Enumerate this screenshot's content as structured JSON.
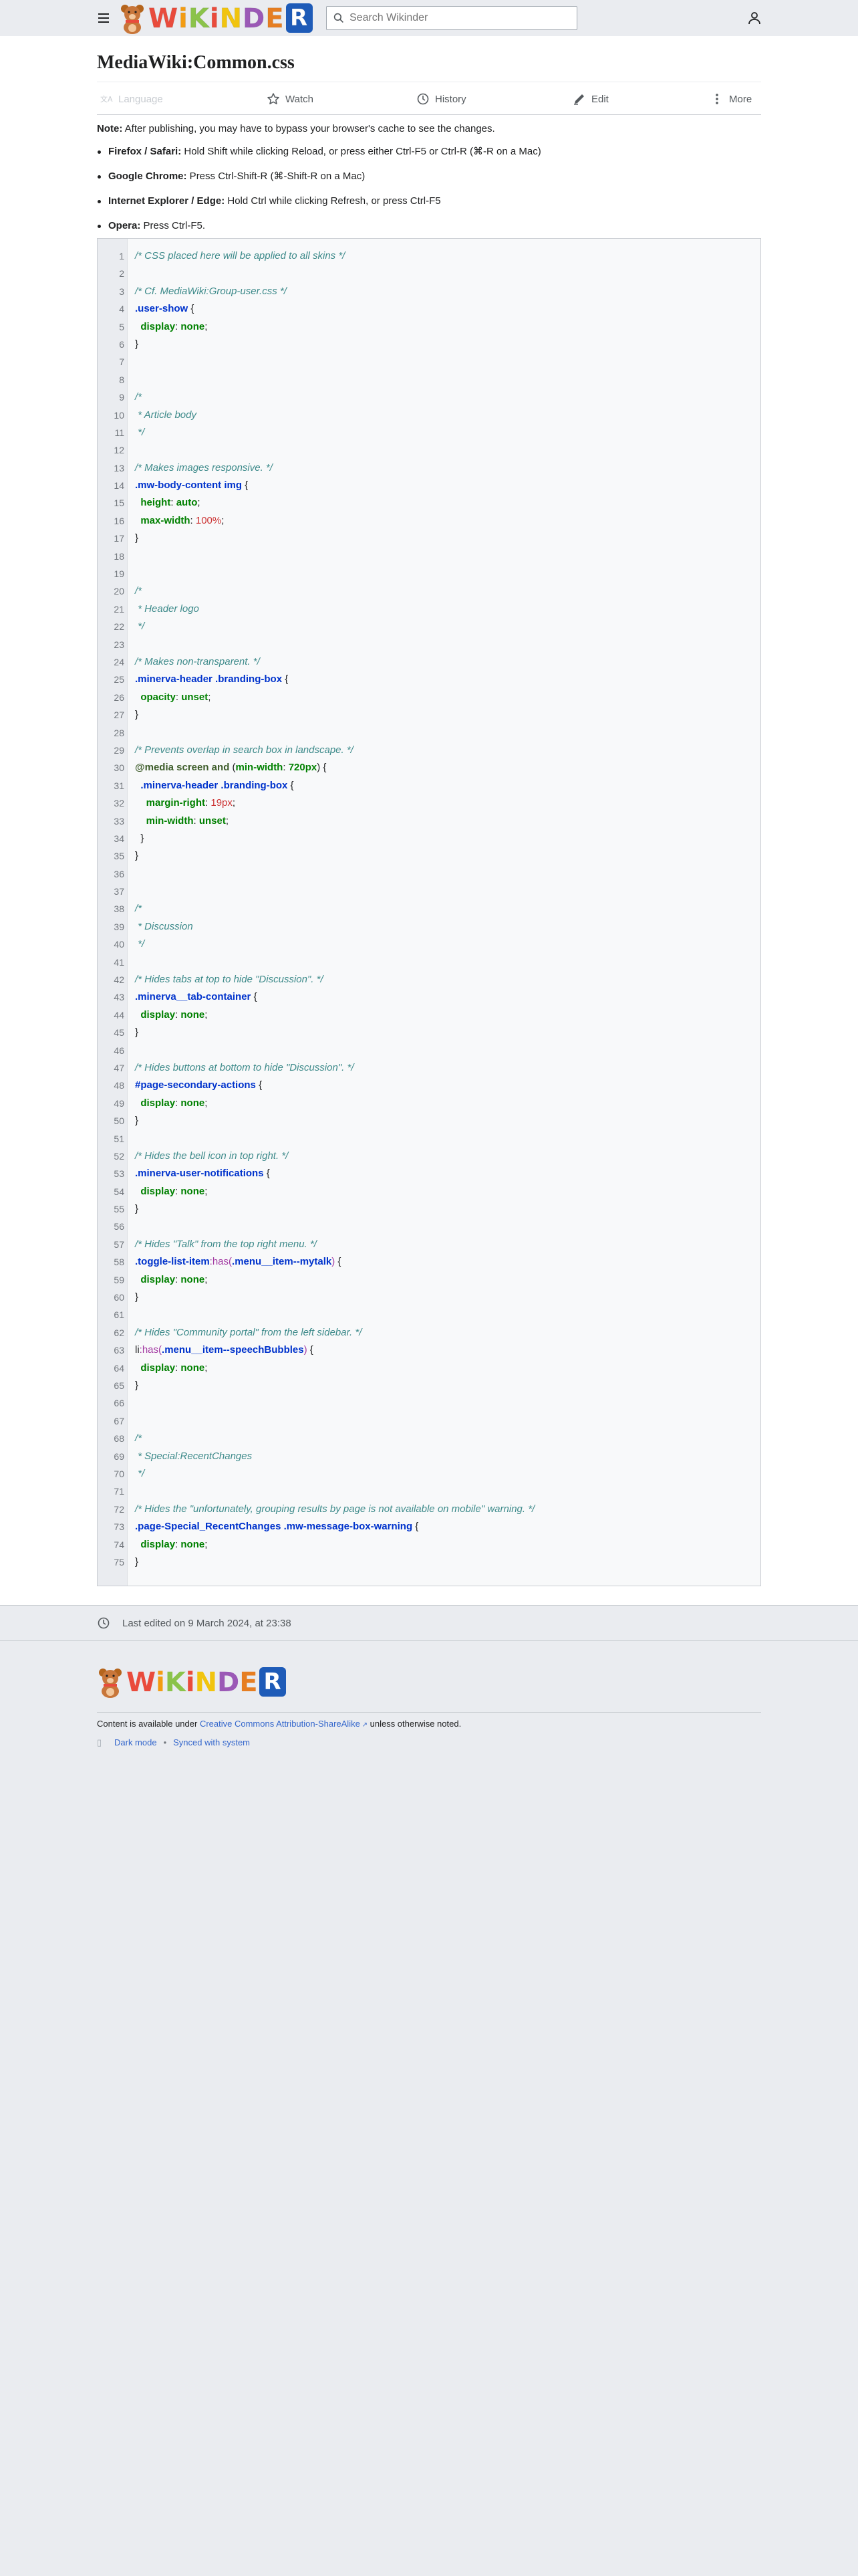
{
  "site": {
    "logo_text": [
      "W",
      "i",
      "K",
      "i",
      "N",
      "D",
      "E",
      "R"
    ],
    "logo_colors": [
      "#e94b3c",
      "#f39c12",
      "#8bc34a",
      "#e94b3c",
      "#f1c40f",
      "#9b59b6",
      "#e67e22",
      "#1e5bb8"
    ],
    "search_placeholder": "Search Wikinder"
  },
  "page": {
    "title": "MediaWiki:Common.css",
    "actions": {
      "language": "Language",
      "watch": "Watch",
      "history": "History",
      "edit": "Edit",
      "more": "More"
    },
    "note_label": "Note:",
    "note_text": " After publishing, you may have to bypass your browser's cache to see the changes.",
    "browsers": [
      {
        "name": "Firefox / Safari:",
        "text": " Hold Shift while clicking Reload, or press either Ctrl-F5 or Ctrl-R (⌘-R on a Mac)"
      },
      {
        "name": "Google Chrome:",
        "text": " Press Ctrl-Shift-R (⌘-Shift-R on a Mac)"
      },
      {
        "name": "Internet Explorer / Edge:",
        "text": " Hold Ctrl while clicking Refresh, or press Ctrl-F5"
      },
      {
        "name": "Opera:",
        "text": " Press Ctrl-F5."
      }
    ]
  },
  "code": [
    [
      [
        "c-comment",
        "/* CSS placed here will be applied to all skins */"
      ]
    ],
    [],
    [
      [
        "c-comment",
        "/* Cf. MediaWiki:Group-user.css */"
      ]
    ],
    [
      [
        "c-sel",
        ".user-show"
      ],
      [
        "c-punc",
        " {"
      ]
    ],
    [
      [
        "c-punc",
        "  "
      ],
      [
        "c-prop",
        "display"
      ],
      [
        "c-punc",
        ": "
      ],
      [
        "c-prop",
        "none"
      ],
      [
        "c-punc",
        ";"
      ]
    ],
    [
      [
        "c-punc",
        "}"
      ]
    ],
    [],
    [],
    [
      [
        "c-comment",
        "/*"
      ]
    ],
    [
      [
        "c-comment",
        " * Article body"
      ]
    ],
    [
      [
        "c-comment",
        " */"
      ]
    ],
    [],
    [
      [
        "c-comment",
        "/* Makes images responsive. */"
      ]
    ],
    [
      [
        "c-sel",
        ".mw-body-content img"
      ],
      [
        "c-punc",
        " {"
      ]
    ],
    [
      [
        "c-punc",
        "  "
      ],
      [
        "c-prop",
        "height"
      ],
      [
        "c-punc",
        ": "
      ],
      [
        "c-prop",
        "auto"
      ],
      [
        "c-punc",
        ";"
      ]
    ],
    [
      [
        "c-punc",
        "  "
      ],
      [
        "c-prop",
        "max-width"
      ],
      [
        "c-punc",
        ": "
      ],
      [
        "c-num",
        "100%"
      ],
      [
        "c-punc",
        ";"
      ]
    ],
    [
      [
        "c-punc",
        "}"
      ]
    ],
    [],
    [],
    [
      [
        "c-comment",
        "/*"
      ]
    ],
    [
      [
        "c-comment",
        " * Header logo"
      ]
    ],
    [
      [
        "c-comment",
        " */"
      ]
    ],
    [],
    [
      [
        "c-comment",
        "/* Makes non-transparent. */"
      ]
    ],
    [
      [
        "c-sel",
        ".minerva-header .branding-box"
      ],
      [
        "c-punc",
        " {"
      ]
    ],
    [
      [
        "c-punc",
        "  "
      ],
      [
        "c-prop",
        "opacity"
      ],
      [
        "c-punc",
        ": "
      ],
      [
        "c-prop",
        "unset"
      ],
      [
        "c-punc",
        ";"
      ]
    ],
    [
      [
        "c-punc",
        "}"
      ]
    ],
    [],
    [
      [
        "c-comment",
        "/* Prevents overlap in search box in landscape. */"
      ]
    ],
    [
      [
        "c-at",
        "@media screen and"
      ],
      [
        "c-punc",
        " ("
      ],
      [
        "c-prop",
        "min-width"
      ],
      [
        "c-punc",
        ": "
      ],
      [
        "c-prop",
        "720px"
      ],
      [
        "c-punc",
        ") {"
      ]
    ],
    [
      [
        "c-punc",
        "  "
      ],
      [
        "c-sel",
        ".minerva-header .branding-box"
      ],
      [
        "c-punc",
        " {"
      ]
    ],
    [
      [
        "c-punc",
        "    "
      ],
      [
        "c-prop",
        "margin-right"
      ],
      [
        "c-punc",
        ": "
      ],
      [
        "c-num",
        "19px"
      ],
      [
        "c-punc",
        ";"
      ]
    ],
    [
      [
        "c-punc",
        "    "
      ],
      [
        "c-prop",
        "min-width"
      ],
      [
        "c-punc",
        ": "
      ],
      [
        "c-prop",
        "unset"
      ],
      [
        "c-punc",
        ";"
      ]
    ],
    [
      [
        "c-punc",
        "  }"
      ]
    ],
    [
      [
        "c-punc",
        "}"
      ]
    ],
    [],
    [],
    [
      [
        "c-comment",
        "/*"
      ]
    ],
    [
      [
        "c-comment",
        " * Discussion"
      ]
    ],
    [
      [
        "c-comment",
        " */"
      ]
    ],
    [],
    [
      [
        "c-comment",
        "/* Hides tabs at top to hide \"Discussion\". */"
      ]
    ],
    [
      [
        "c-sel",
        ".minerva__tab-container"
      ],
      [
        "c-punc",
        " {"
      ]
    ],
    [
      [
        "c-punc",
        "  "
      ],
      [
        "c-prop",
        "display"
      ],
      [
        "c-punc",
        ": "
      ],
      [
        "c-prop",
        "none"
      ],
      [
        "c-punc",
        ";"
      ]
    ],
    [
      [
        "c-punc",
        "}"
      ]
    ],
    [],
    [
      [
        "c-comment",
        "/* Hides buttons at bottom to hide \"Discussion\". */"
      ]
    ],
    [
      [
        "c-sel",
        "#page-secondary-actions"
      ],
      [
        "c-punc",
        " {"
      ]
    ],
    [
      [
        "c-punc",
        "  "
      ],
      [
        "c-prop",
        "display"
      ],
      [
        "c-punc",
        ": "
      ],
      [
        "c-prop",
        "none"
      ],
      [
        "c-punc",
        ";"
      ]
    ],
    [
      [
        "c-punc",
        "}"
      ]
    ],
    [],
    [
      [
        "c-comment",
        "/* Hides the bell icon in top right. */"
      ]
    ],
    [
      [
        "c-sel",
        ".minerva-user-notifications"
      ],
      [
        "c-punc",
        " {"
      ]
    ],
    [
      [
        "c-punc",
        "  "
      ],
      [
        "c-prop",
        "display"
      ],
      [
        "c-punc",
        ": "
      ],
      [
        "c-prop",
        "none"
      ],
      [
        "c-punc",
        ";"
      ]
    ],
    [
      [
        "c-punc",
        "}"
      ]
    ],
    [],
    [
      [
        "c-comment",
        "/* Hides \"Talk\" from the top right menu. */"
      ]
    ],
    [
      [
        "c-sel",
        ".toggle-list-item"
      ],
      [
        "c-pseudo",
        ":has("
      ],
      [
        "c-sel",
        ".menu__item--mytalk"
      ],
      [
        "c-pseudo",
        ")"
      ],
      [
        "c-punc",
        " {"
      ]
    ],
    [
      [
        "c-punc",
        "  "
      ],
      [
        "c-prop",
        "display"
      ],
      [
        "c-punc",
        ": "
      ],
      [
        "c-prop",
        "none"
      ],
      [
        "c-punc",
        ";"
      ]
    ],
    [
      [
        "c-punc",
        "}"
      ]
    ],
    [],
    [
      [
        "c-comment",
        "/* Hides \"Community portal\" from the left sidebar. */"
      ]
    ],
    [
      [
        "c-punc",
        "li"
      ],
      [
        "c-pseudo",
        ":has("
      ],
      [
        "c-sel",
        ".menu__item--speechBubbles"
      ],
      [
        "c-pseudo",
        ")"
      ],
      [
        "c-punc",
        " {"
      ]
    ],
    [
      [
        "c-punc",
        "  "
      ],
      [
        "c-prop",
        "display"
      ],
      [
        "c-punc",
        ": "
      ],
      [
        "c-prop",
        "none"
      ],
      [
        "c-punc",
        ";"
      ]
    ],
    [
      [
        "c-punc",
        "}"
      ]
    ],
    [],
    [],
    [
      [
        "c-comment",
        "/*"
      ]
    ],
    [
      [
        "c-comment",
        " * Special:RecentChanges"
      ]
    ],
    [
      [
        "c-comment",
        " */"
      ]
    ],
    [],
    [
      [
        "c-comment",
        "/* Hides the \"unfortunately, grouping results by page is not available on mobile\" warning. */"
      ]
    ],
    [
      [
        "c-sel",
        ".page-Special_RecentChanges .mw-message-box-warning"
      ],
      [
        "c-punc",
        " {"
      ]
    ],
    [
      [
        "c-punc",
        "  "
      ],
      [
        "c-prop",
        "display"
      ],
      [
        "c-punc",
        ": "
      ],
      [
        "c-prop",
        "none"
      ],
      [
        "c-punc",
        ";"
      ]
    ],
    [
      [
        "c-punc",
        "}"
      ]
    ]
  ],
  "last_edited": "Last edited on 9 March 2024, at 23:38",
  "footer": {
    "license_prefix": "Content is available under ",
    "license_link": "Creative Commons Attribution-ShareAlike",
    "license_suffix": " unless otherwise noted.",
    "dark_mode": "Dark mode",
    "synced": "Synced with system"
  }
}
